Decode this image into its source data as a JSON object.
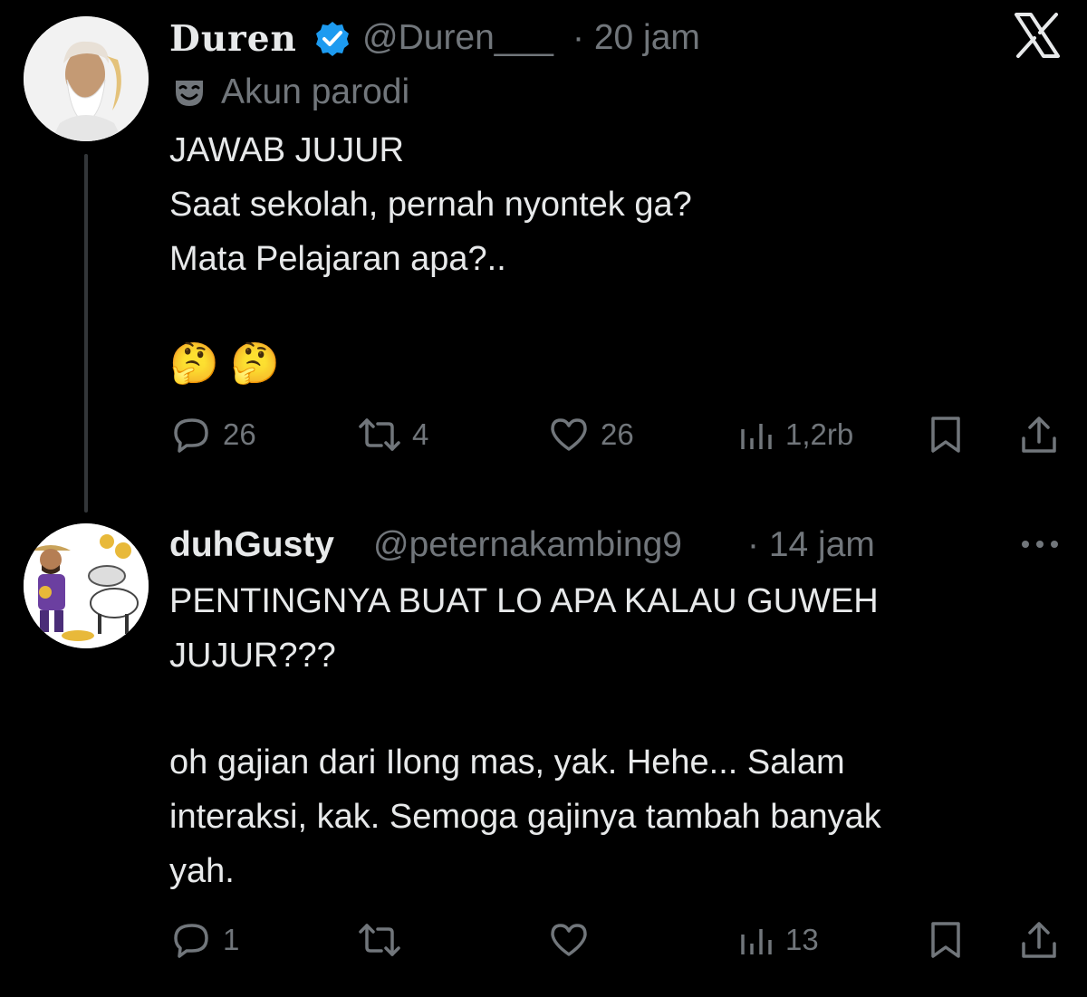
{
  "tweet": {
    "display_name": "Duren",
    "verified": true,
    "handle": "@Duren___",
    "time": "· 20 jam",
    "label": "Akun parodi",
    "label_icon": "mask-icon",
    "lines": [
      "JAWAB JUJUR",
      "Saat sekolah, pernah nyontek ga?",
      "Mata Pelajaran apa?.."
    ],
    "emoji": "🤔 🤔",
    "actions": {
      "replies": "26",
      "retweets": "4",
      "likes": "26",
      "views": "1,2rb"
    }
  },
  "reply": {
    "display_name": "duhGusty",
    "handle": "@peternakambing9",
    "time": "· 14 jam",
    "paragraph1": "PENTINGNYA BUAT LO APA KALAU GUWEH\nJUJUR???",
    "paragraph2": "oh gajian dari Ilong mas, yak. Hehe... Salam\ninteraksi, kak. Semoga gajinya tambah banyak\nyah.",
    "actions": {
      "replies": "1",
      "retweets": "",
      "likes": "",
      "views": "13"
    }
  },
  "header": {
    "close_icon": "x-logo-icon"
  },
  "colors": {
    "background": "#000000",
    "text": "#e7e9ea",
    "muted": "#71767b",
    "verified": "#1d9bf0"
  }
}
